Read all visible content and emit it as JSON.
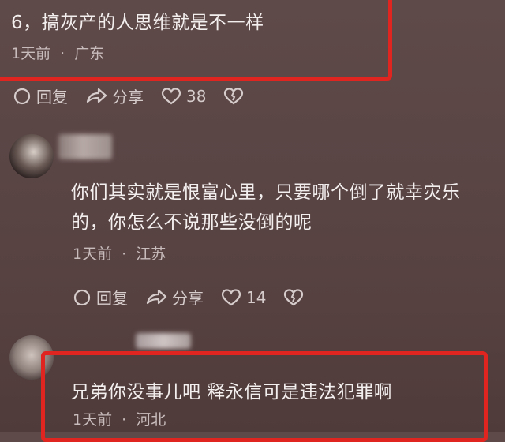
{
  "comments": [
    {
      "text": "6，搞灰产的人思维就是不一样",
      "time": "1天前",
      "dot": "·",
      "location": "广东",
      "reply_label": "回复",
      "share_label": "分享",
      "like_count": "38"
    },
    {
      "text_line1": "你们其实就是恨富心里，只要哪个倒了就幸灾乐",
      "text_line2": "的，你怎么不说那些没倒的呢",
      "time": "1天前",
      "dot": "·",
      "location": "江苏",
      "reply_label": "回复",
      "share_label": "分享",
      "like_count": "14"
    },
    {
      "text": "兄弟你没事儿吧 释永信可是违法犯罪啊",
      "time": "1天前",
      "dot": "·",
      "location": "河北"
    }
  ],
  "colors": {
    "highlight": "#e0241f",
    "background": "#5a4545"
  }
}
